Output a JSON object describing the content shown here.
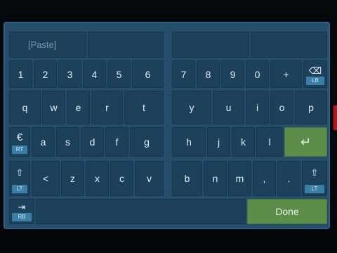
{
  "top_bar": {
    "left_text": "",
    "right_text": ""
  },
  "keyboard": {
    "paste_label": "[Paste]",
    "number_row": [
      "1",
      "2",
      "3",
      "4",
      "5",
      "6",
      "7",
      "8",
      "9",
      "0",
      "+"
    ],
    "backspace_glyph": "⌫",
    "backspace_hint": "LB",
    "row_q": [
      "q",
      "w",
      "e",
      "r",
      "t",
      "y",
      "u",
      "i",
      "o",
      "p"
    ],
    "euro_key": "€",
    "euro_hint": "RT",
    "row_a": [
      "a",
      "s",
      "d",
      "f",
      "g",
      "h",
      "j",
      "k",
      "l"
    ],
    "enter_glyph": "↵",
    "shift_glyph": "⇧",
    "shift_hint": "LT",
    "row_z": [
      "<",
      "z",
      "x",
      "c",
      "v",
      "b",
      "n",
      "m",
      ",",
      "."
    ],
    "tab_glyph": "⇥",
    "tab_hint": "RB",
    "done_label": "Done",
    "colors": {
      "panel": "#244e6b",
      "key": "#1d415a",
      "hint": "#3a7fa8",
      "accent_green": "#5d8e49"
    }
  }
}
